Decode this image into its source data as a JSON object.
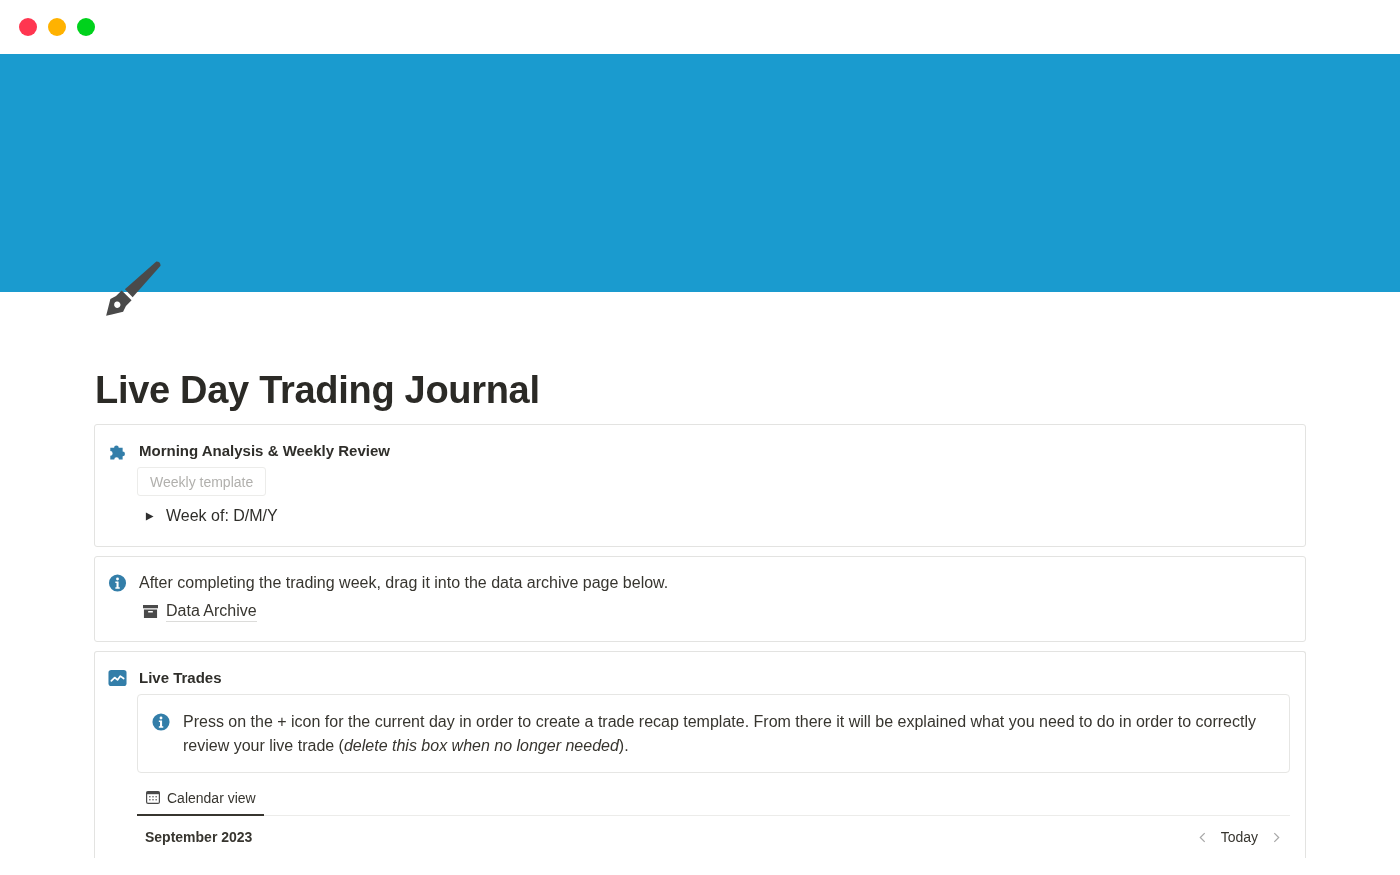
{
  "window": {
    "controls": [
      {
        "color": "#ff3650"
      },
      {
        "color": "#ffb200"
      },
      {
        "color": "#00d21c"
      }
    ]
  },
  "page": {
    "title": "Live Day Trading Journal"
  },
  "morning_analysis": {
    "heading": "Morning Analysis & Weekly Review",
    "template_button": "Weekly template",
    "toggle": {
      "label": "Week of: D/M/Y",
      "expanded": false
    }
  },
  "archive_note": {
    "text": "After completing the trading week, drag it into the data archive page below.",
    "page_link": "Data Archive"
  },
  "live_trades": {
    "heading": "Live Trades",
    "callout": "Press on the + icon for the current day in order to create a trade recap template. From there it will be explained what you need to do in order to correctly review your live trade (*delete this box when no longer needed*).",
    "views": [
      {
        "label": "Calendar view",
        "selected": true
      }
    ],
    "calendar": {
      "month": "September 2023",
      "today_button": "Today"
    }
  }
}
